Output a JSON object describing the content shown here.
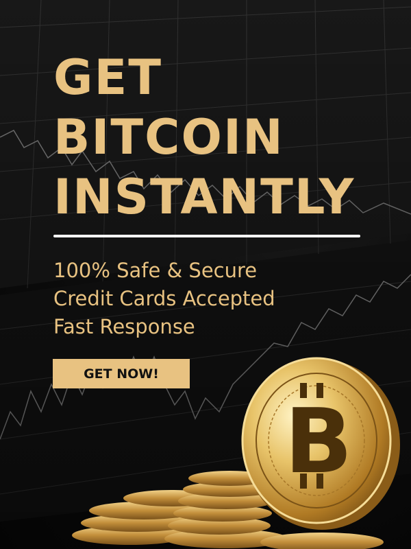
{
  "headline": [
    "GET",
    "BITCOIN",
    "INSTANTLY"
  ],
  "features": [
    "100% Safe & Secure",
    "Credit Cards Accepted",
    "Fast Response"
  ],
  "cta": {
    "label": "GET NOW!"
  },
  "coin": {
    "symbol": "B"
  },
  "colors": {
    "accent": "#e8c281",
    "divider": "#ffffff",
    "background": "#111111",
    "button_text": "#111111"
  }
}
